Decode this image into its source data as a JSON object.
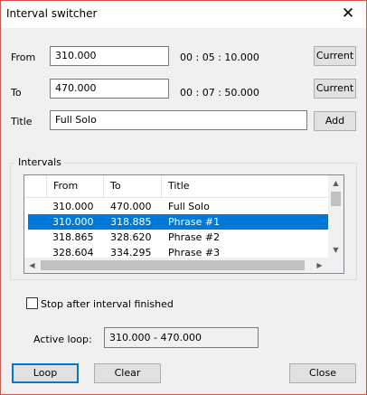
{
  "window": {
    "title": "Interval switcher",
    "close_glyph": "✕"
  },
  "form": {
    "from_label": "From",
    "from_value": "310.000",
    "from_time": "00 : 05 : 10.000",
    "to_label": "To",
    "to_value": "470.000",
    "to_time": "00 : 07 : 50.000",
    "title_label": "Title",
    "title_value": "Full Solo",
    "current_label": "Current",
    "add_label": "Add"
  },
  "intervals": {
    "group_label": "Intervals",
    "columns": [
      "",
      "From",
      "To",
      "Title"
    ],
    "rows": [
      {
        "from": "310.000",
        "to": "470.000",
        "title": "Full Solo",
        "selected": false
      },
      {
        "from": "310.000",
        "to": "318.885",
        "title": "Phrase #1",
        "selected": true
      },
      {
        "from": "318.865",
        "to": "328.620",
        "title": "Phrase #2",
        "selected": false
      },
      {
        "from": "328.604",
        "to": "334.295",
        "title": "Phrase #3",
        "selected": false
      }
    ]
  },
  "options": {
    "stop_after_label": "Stop after interval finished",
    "stop_after_checked": false,
    "active_loop_label": "Active loop:",
    "active_loop_value": "310.000 - 470.000"
  },
  "buttons": {
    "loop": "Loop",
    "clear": "Clear",
    "close": "Close"
  },
  "colors": {
    "selection": "#0078d7",
    "accent_border": "#0078d7",
    "window_border": "#d9534a"
  },
  "icons": {
    "scroll_up": "chevron-up-icon",
    "scroll_down": "chevron-down-icon",
    "scroll_left": "chevron-left-icon",
    "scroll_right": "chevron-right-icon"
  }
}
